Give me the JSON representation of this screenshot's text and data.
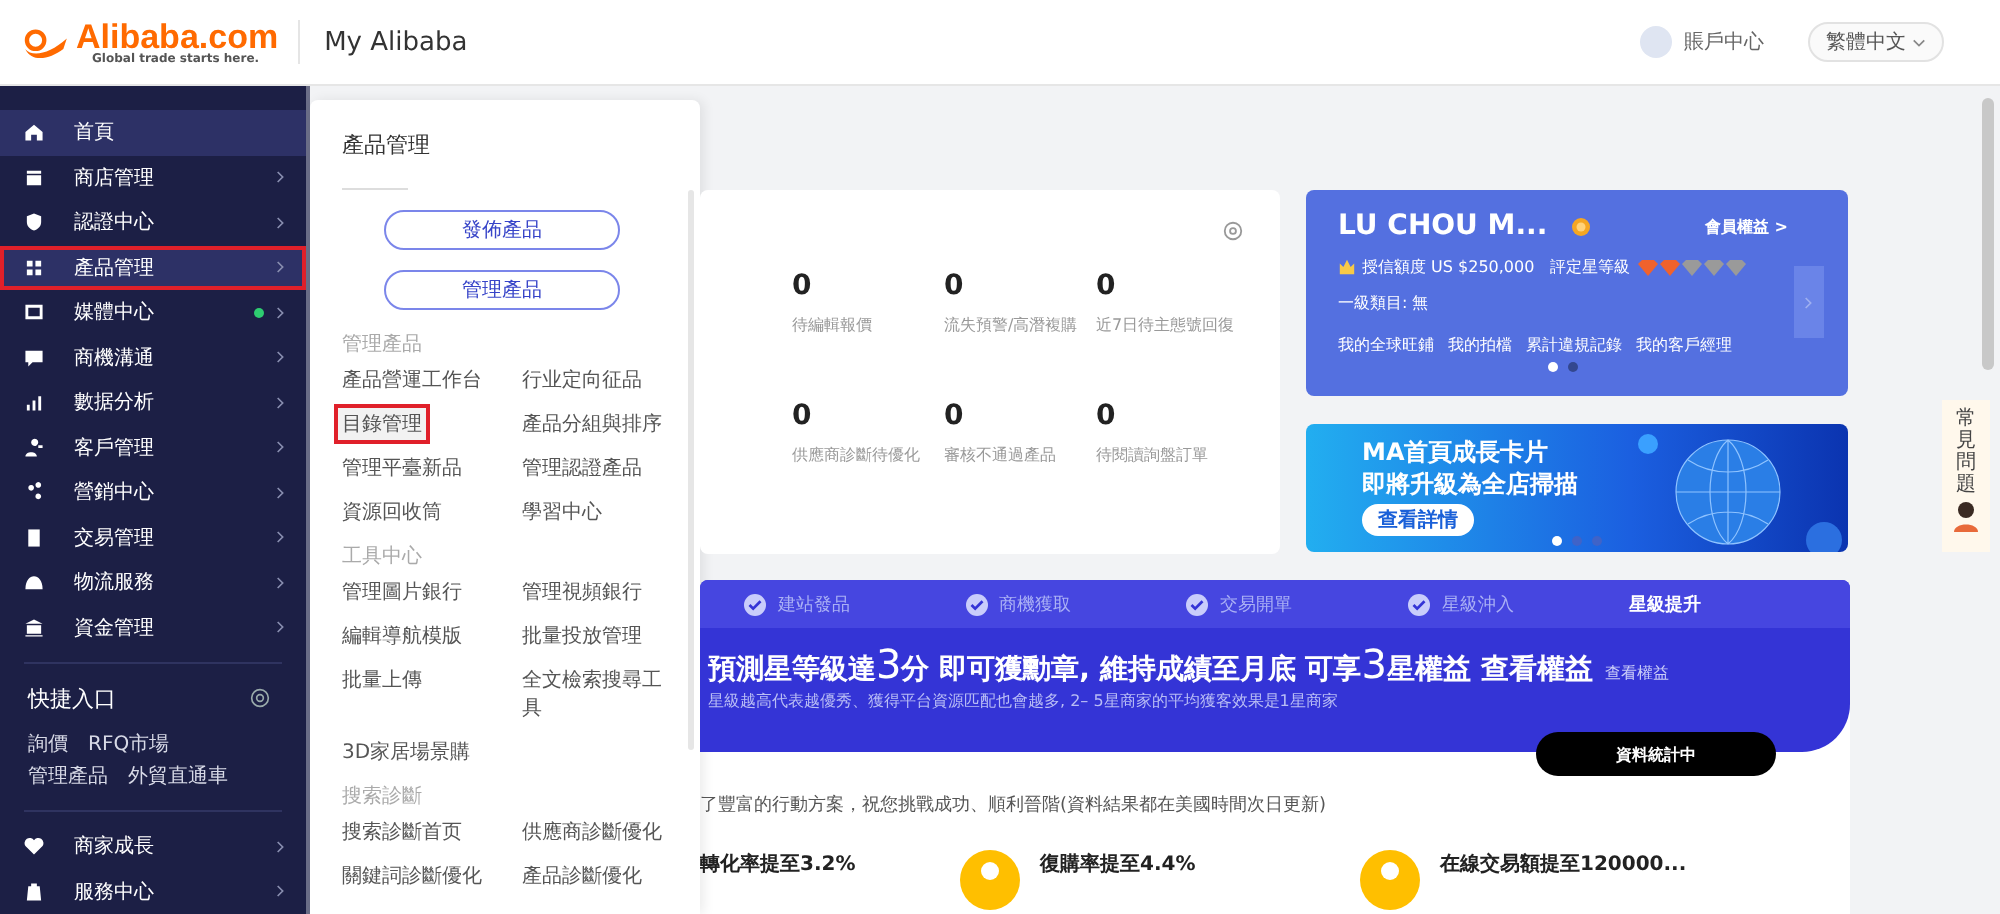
{
  "header": {
    "logo": "Alibaba.com",
    "logo_tagline": "Global trade starts here.",
    "title": "My Alibaba",
    "account": "賬戶中心",
    "language": "繁體中文"
  },
  "sidebar": {
    "items": [
      {
        "label": "首頁",
        "selected": true,
        "highlighted": false,
        "expandable": false,
        "notification": false
      },
      {
        "label": "商店管理",
        "selected": false,
        "highlighted": false,
        "expandable": true,
        "notification": false
      },
      {
        "label": "認證中心",
        "selected": false,
        "highlighted": false,
        "expandable": true,
        "notification": false
      },
      {
        "label": "產品管理",
        "selected": true,
        "highlighted": true,
        "expandable": true,
        "notification": false
      },
      {
        "label": "媒體中心",
        "selected": false,
        "highlighted": false,
        "expandable": true,
        "notification": true
      },
      {
        "label": "商機溝通",
        "selected": false,
        "highlighted": false,
        "expandable": true,
        "notification": false
      },
      {
        "label": "數据分析",
        "selected": false,
        "highlighted": false,
        "expandable": true,
        "notification": false
      },
      {
        "label": "客戶管理",
        "selected": false,
        "highlighted": false,
        "expandable": true,
        "notification": false
      },
      {
        "label": "營銷中心",
        "selected": false,
        "highlighted": false,
        "expandable": true,
        "notification": false
      },
      {
        "label": "交易管理",
        "selected": false,
        "highlighted": false,
        "expandable": true,
        "notification": false
      },
      {
        "label": "物流服務",
        "selected": false,
        "highlighted": false,
        "expandable": true,
        "notification": false
      },
      {
        "label": "資金管理",
        "selected": false,
        "highlighted": false,
        "expandable": true,
        "notification": false
      }
    ],
    "quick_access": {
      "title": "快捷入口",
      "links": [
        "詢價",
        "RFQ市場",
        "管理產品",
        "外貿直通車"
      ]
    },
    "bottom_items": [
      {
        "label": "商家成長",
        "selected": false,
        "highlighted": false,
        "expandable": true,
        "notification": false
      },
      {
        "label": "服務中心",
        "selected": false,
        "highlighted": false,
        "expandable": true,
        "notification": false
      }
    ]
  },
  "flyout": {
    "title": "產品管理",
    "buttons": [
      "發佈產品",
      "管理產品"
    ],
    "sections": [
      {
        "title": "管理產品",
        "links": [
          {
            "label": "產品營運工作台",
            "selected": false,
            "highlighted": false
          },
          {
            "label": "行业定向征品",
            "selected": false,
            "highlighted": false
          },
          {
            "label": "目錄管理",
            "selected": true,
            "highlighted": true
          },
          {
            "label": "產品分組與排序",
            "selected": false,
            "highlighted": false
          },
          {
            "label": "管理平臺新品",
            "selected": false,
            "highlighted": false
          },
          {
            "label": "管理認證產品",
            "selected": false,
            "highlighted": false
          },
          {
            "label": "資源回收筒",
            "selected": false,
            "highlighted": false
          },
          {
            "label": "學習中心",
            "selected": false,
            "highlighted": false
          }
        ]
      },
      {
        "title": "工具中心",
        "links": [
          {
            "label": "管理圖片銀行",
            "selected": false,
            "highlighted": false
          },
          {
            "label": "管理視頻銀行",
            "selected": false,
            "highlighted": false
          },
          {
            "label": "編輯導航模版",
            "selected": false,
            "highlighted": false
          },
          {
            "label": "批量投放管理",
            "selected": false,
            "highlighted": false
          },
          {
            "label": "批量上傳",
            "selected": false,
            "highlighted": false
          },
          {
            "label": "全文檢索搜尋工具",
            "selected": false,
            "highlighted": false
          },
          {
            "label": "3D家居場景購",
            "selected": false,
            "highlighted": false
          }
        ]
      },
      {
        "title": "搜索診斷",
        "links": [
          {
            "label": "搜索診斷首页",
            "selected": false,
            "highlighted": false
          },
          {
            "label": "供應商診斷優化",
            "selected": false,
            "highlighted": false
          },
          {
            "label": "關鍵詞診斷優化",
            "selected": false,
            "highlighted": false
          },
          {
            "label": "產品診斷優化",
            "selected": false,
            "highlighted": false
          }
        ]
      }
    ]
  },
  "stats_card": {
    "stats": [
      {
        "value": "0",
        "label": "待編輯報價"
      },
      {
        "value": "0",
        "label": "流失預警/高潛複購"
      },
      {
        "value": "0",
        "label": "近7日待主態號回復"
      },
      {
        "value": "0",
        "label": "供應商診斷待優化"
      },
      {
        "value": "0",
        "label": "審核不通過產品"
      },
      {
        "value": "0",
        "label": "待閱讀詢盤訂單"
      }
    ]
  },
  "member_card": {
    "company": "LU CHOU M...",
    "benefits": "會員權益 >",
    "credit": "授信額度 US $250,000",
    "star_label": "評定星等級",
    "stars": 2,
    "category": "一級類目: 無",
    "links": [
      "我的全球旺鋪",
      "我的拍檔",
      "累計違規記錄",
      "我的客戶經理"
    ],
    "carousel_dots": [
      {
        "selected": true
      },
      {
        "selected": false
      }
    ]
  },
  "banner": {
    "lines": [
      "MA首頁成長卡片",
      "即將升級為全店掃描"
    ],
    "button": "查看詳情",
    "carousel_dots": [
      {
        "selected": true
      },
      {
        "selected": false
      },
      {
        "selected": false
      }
    ]
  },
  "growth_card": {
    "steps": [
      {
        "label": "建站發品",
        "done": true,
        "selected": false
      },
      {
        "label": "商機獲取",
        "done": true,
        "selected": false
      },
      {
        "label": "交易開單",
        "done": true,
        "selected": false
      },
      {
        "label": "星級沖入",
        "done": true,
        "selected": false
      },
      {
        "label": "星級提升",
        "done": false,
        "selected": true
      }
    ],
    "headline": [
      {
        "text": "預測星等級達",
        "kind": "normal"
      },
      {
        "text": "3",
        "kind": "big"
      },
      {
        "text": "分 即可獲勳章, 維持成績至月底 可享",
        "kind": "normal"
      },
      {
        "text": "3",
        "kind": "big"
      },
      {
        "text": "星權益 查看權益",
        "kind": "normal"
      }
    ],
    "headline_link": "查看權益",
    "subtitle": "星級越高代表越優秀、獲得平台資源匹配也會越多, 2– 5星商家的平均獲客效果是1星商家",
    "button": "資料統計中",
    "note": "了豐富的行動方案，祝您挑戰成功、順利晉階(資料結果都在美國時間次日更新)",
    "goals": [
      "轉化率提至3.2%",
      "復購率提至4.4%",
      "在線交易額提至120000..."
    ]
  },
  "faq": {
    "label": "常見問題"
  }
}
